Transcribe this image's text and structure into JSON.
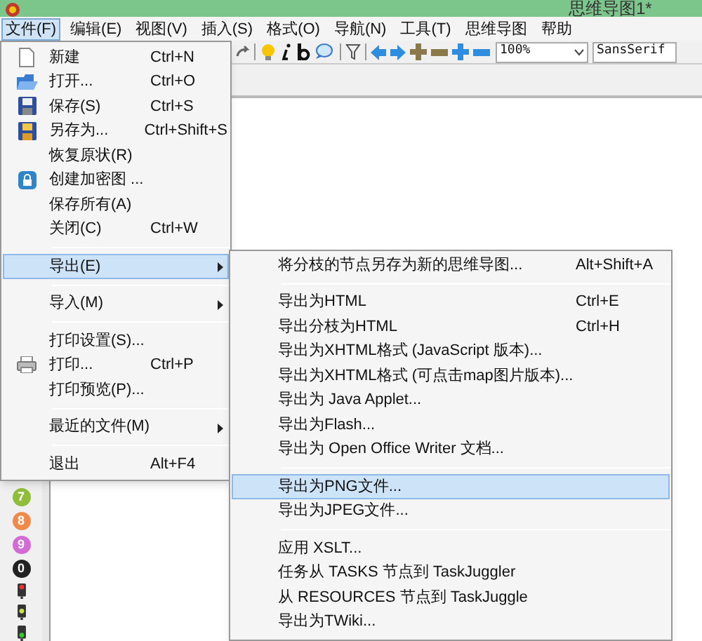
{
  "window": {
    "title": "思维导图1*"
  },
  "menu_bar": [
    {
      "label": "文件(F)",
      "selected": true
    },
    {
      "label": "编辑(E)",
      "selected": false
    },
    {
      "label": "视图(V)",
      "selected": false
    },
    {
      "label": "插入(S)",
      "selected": false
    },
    {
      "label": "格式(O)",
      "selected": false
    },
    {
      "label": "导航(N)",
      "selected": false
    },
    {
      "label": "工具(T)",
      "selected": false
    },
    {
      "label": "思维导图",
      "selected": false
    },
    {
      "label": "帮助",
      "selected": false
    }
  ],
  "toolbar": {
    "zoom": "100%",
    "font": "SansSerif"
  },
  "file_menu": [
    {
      "kind": "item",
      "label": "新建",
      "shortcut": "Ctrl+N",
      "selected": false,
      "has_submenu": false
    },
    {
      "kind": "item",
      "label": "打开...",
      "shortcut": "Ctrl+O",
      "selected": false,
      "has_submenu": false
    },
    {
      "kind": "item",
      "label": "保存(S)",
      "shortcut": "Ctrl+S",
      "selected": false,
      "has_submenu": false
    },
    {
      "kind": "item",
      "label": "另存为...",
      "shortcut": "Ctrl+Shift+S",
      "selected": false,
      "has_submenu": false
    },
    {
      "kind": "item",
      "label": "恢复原状(R)",
      "selected": false,
      "has_submenu": false
    },
    {
      "kind": "item",
      "label": "创建加密图 ...",
      "selected": false,
      "has_submenu": false
    },
    {
      "kind": "item",
      "label": "保存所有(A)",
      "selected": false,
      "has_submenu": false
    },
    {
      "kind": "item",
      "label": "关闭(C)",
      "shortcut": "Ctrl+W",
      "selected": false,
      "has_submenu": false
    },
    {
      "kind": "separator"
    },
    {
      "kind": "item",
      "label": "导出(E)",
      "selected": true,
      "has_submenu": true
    },
    {
      "kind": "separator"
    },
    {
      "kind": "item",
      "label": "导入(M)",
      "selected": false,
      "has_submenu": true
    },
    {
      "kind": "separator"
    },
    {
      "kind": "item",
      "label": "打印设置(S)...",
      "selected": false,
      "has_submenu": false
    },
    {
      "kind": "item",
      "label": "打印...",
      "shortcut": "Ctrl+P",
      "selected": false,
      "has_submenu": false
    },
    {
      "kind": "item",
      "label": "打印预览(P)...",
      "selected": false,
      "has_submenu": false
    },
    {
      "kind": "separator"
    },
    {
      "kind": "item",
      "label": "最近的文件(M)",
      "selected": false,
      "has_submenu": true
    },
    {
      "kind": "separator"
    },
    {
      "kind": "item",
      "label": "退出",
      "shortcut": "Alt+F4",
      "selected": false,
      "has_submenu": false
    }
  ],
  "export_submenu": [
    {
      "kind": "item",
      "label": "将分枝的节点另存为新的思维导图...",
      "shortcut": "Alt+Shift+A",
      "selected": false
    },
    {
      "kind": "separator"
    },
    {
      "kind": "item",
      "label": "导出为HTML",
      "shortcut": "Ctrl+E",
      "selected": false
    },
    {
      "kind": "item",
      "label": "导出分枝为HTML",
      "shortcut": "Ctrl+H",
      "selected": false
    },
    {
      "kind": "item",
      "label": "导出为XHTML格式 (JavaScript 版本)...",
      "selected": false
    },
    {
      "kind": "item",
      "label": "导出为XHTML格式 (可点击map图片版本)...",
      "selected": false
    },
    {
      "kind": "item",
      "label": "导出为 Java Applet...",
      "selected": false
    },
    {
      "kind": "item",
      "label": "导出为Flash...",
      "selected": false
    },
    {
      "kind": "item",
      "label": "导出为 Open Office Writer 文档...",
      "selected": false
    },
    {
      "kind": "separator"
    },
    {
      "kind": "item",
      "label": "导出为PNG文件...",
      "selected": true
    },
    {
      "kind": "item",
      "label": "导出为JPEG文件...",
      "selected": false
    },
    {
      "kind": "separator"
    },
    {
      "kind": "item",
      "label": "应用 XSLT...",
      "selected": false
    },
    {
      "kind": "item",
      "label": "任务从 TASKS 节点到 TaskJuggler",
      "selected": false
    },
    {
      "kind": "item",
      "label": "从 RESOURCES 节点到 TaskJuggle",
      "selected": false
    },
    {
      "kind": "item",
      "label": "导出为TWiki...",
      "selected": false
    }
  ],
  "icon_badges": [
    {
      "label": "7",
      "color": "#8fbf3a"
    },
    {
      "label": "8",
      "color": "#f08a4b"
    },
    {
      "label": "9",
      "color": "#d36bd6"
    },
    {
      "label": "0",
      "color": "#222222"
    }
  ]
}
